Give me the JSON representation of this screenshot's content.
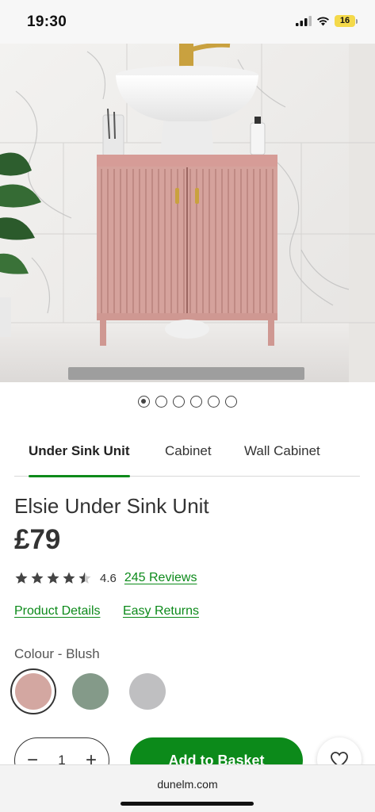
{
  "status_bar": {
    "time": "19:30",
    "battery": "16"
  },
  "gallery": {
    "slide_count": 6,
    "active_index": 0
  },
  "tabs": [
    {
      "label": "Under Sink Unit",
      "active": true
    },
    {
      "label": "Cabinet",
      "active": false
    },
    {
      "label": "Wall Cabinet",
      "active": false
    }
  ],
  "product": {
    "title": "Elsie Under Sink Unit",
    "price": "£79",
    "rating": "4.6",
    "stars": 4.6,
    "reviews_link": "245 Reviews",
    "details_link": "Product Details",
    "returns_link": "Easy Returns",
    "colour_label": "Colour - Blush",
    "colours": [
      {
        "name": "blush",
        "hex": "#d3a7a1",
        "selected": true
      },
      {
        "name": "sage",
        "hex": "#849a89",
        "selected": false
      },
      {
        "name": "grey",
        "hex": "#bfbfc1",
        "selected": false
      }
    ]
  },
  "purchase": {
    "quantity": "1",
    "minus_icon": "minus-icon",
    "plus_icon": "plus-icon",
    "add_label": "Add to Basket",
    "wishlist_icon": "heart-icon"
  },
  "browser": {
    "url": "dunelm.com"
  },
  "colors": {
    "accent": "#0c8a1a",
    "text": "#333333"
  }
}
